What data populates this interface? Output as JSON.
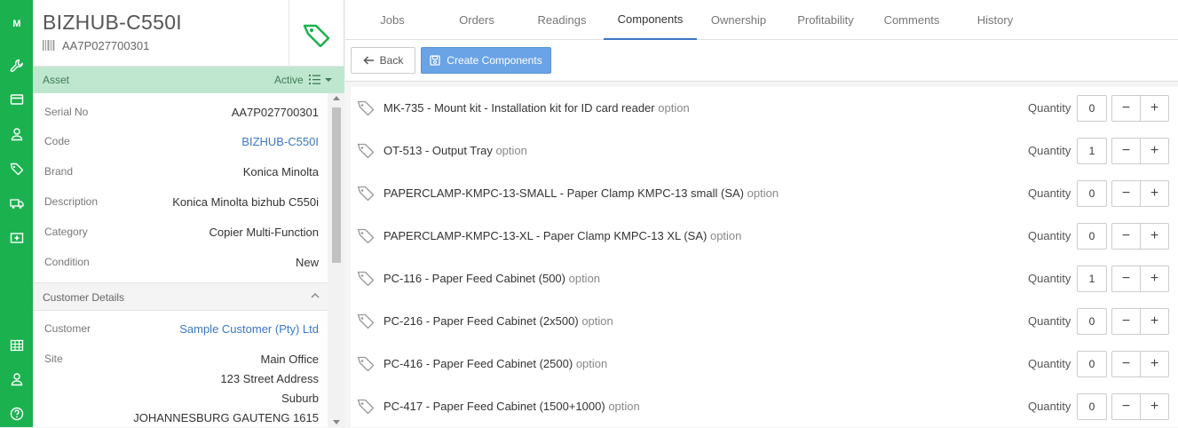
{
  "rail": {
    "logo": "M",
    "icons": [
      "wrench-icon",
      "card-icon",
      "user-icon",
      "tag-icon",
      "truck-icon",
      "medical-icon",
      "table-icon",
      "user-icon",
      "help-icon"
    ]
  },
  "asset": {
    "title": "BIZHUB-C550I",
    "serial": "AA7P027700301",
    "bar_label": "Asset",
    "status": "Active"
  },
  "details": [
    {
      "key": "Serial No",
      "value": "AA7P027700301",
      "link": false
    },
    {
      "key": "Code",
      "value": "BIZHUB-C550I",
      "link": true
    },
    {
      "key": "Brand",
      "value": "Konica Minolta",
      "link": false
    },
    {
      "key": "Description",
      "value": "Konica Minolta bizhub C550i",
      "link": false
    },
    {
      "key": "Category",
      "value": "Copier Multi-Function",
      "link": false
    },
    {
      "key": "Condition",
      "value": "New",
      "link": false
    }
  ],
  "customer_section": {
    "title": "Customer Details",
    "customer_label": "Customer",
    "customer_value": "Sample Customer (Pty) Ltd",
    "site_label": "Site",
    "site_lines": [
      "Main Office",
      "123 Street Address",
      "Suburb",
      "JOHANNESBURG GAUTENG 1615"
    ]
  },
  "tabs": [
    "Jobs",
    "Orders",
    "Readings",
    "Components",
    "Ownership",
    "Profitability",
    "Comments",
    "History"
  ],
  "active_tab": "Components",
  "toolbar": {
    "back_label": "Back",
    "create_label": "Create Components"
  },
  "components": [
    {
      "name": "MK-735 - Mount kit - Installation kit for ID card reader",
      "tag": "option",
      "qty_label": "Quantity",
      "qty": "0"
    },
    {
      "name": "OT-513 - Output Tray",
      "tag": "option",
      "qty_label": "Quantity",
      "qty": "1"
    },
    {
      "name": "PAPERCLAMP-KMPC-13-SMALL - Paper Clamp KMPC-13 small (SA)",
      "tag": "option",
      "qty_label": "Quantity",
      "qty": "0"
    },
    {
      "name": "PAPERCLAMP-KMPC-13-XL - Paper Clamp KMPC-13 XL (SA)",
      "tag": "option",
      "qty_label": "Quantity",
      "qty": "0"
    },
    {
      "name": "PC-116 - Paper Feed Cabinet (500)",
      "tag": "option",
      "qty_label": "Quantity",
      "qty": "1"
    },
    {
      "name": "PC-216 - Paper Feed Cabinet (2x500)",
      "tag": "option",
      "qty_label": "Quantity",
      "qty": "0"
    },
    {
      "name": "PC-416 - Paper Feed Cabinet (2500)",
      "tag": "option",
      "qty_label": "Quantity",
      "qty": "0"
    },
    {
      "name": "PC-417 - Paper Feed Cabinet (1500+1000)",
      "tag": "option",
      "qty_label": "Quantity",
      "qty": "0"
    }
  ],
  "colors": {
    "brand_green": "#1cb14f",
    "asset_bar": "#bfe7cf",
    "link_blue": "#3a78c3",
    "primary_button": "#6aa3e6"
  }
}
